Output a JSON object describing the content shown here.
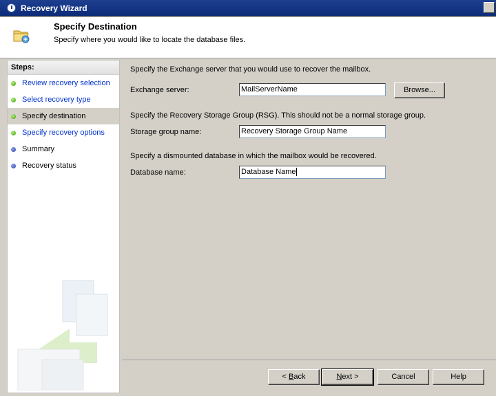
{
  "window": {
    "title": "Recovery Wizard"
  },
  "header": {
    "title": "Specify Destination",
    "subtitle": "Specify where you would like to locate the database files."
  },
  "steps": {
    "title": "Steps:",
    "items": [
      {
        "label": "Review recovery selection",
        "status": "complete",
        "link": true
      },
      {
        "label": "Select recovery type",
        "status": "complete",
        "link": true
      },
      {
        "label": "Specify destination",
        "status": "current",
        "link": false
      },
      {
        "label": "Specify recovery options",
        "status": "complete",
        "link": true
      },
      {
        "label": "Summary",
        "status": "pending",
        "link": false
      },
      {
        "label": "Recovery status",
        "status": "pending",
        "link": false
      }
    ]
  },
  "form": {
    "exchange_desc": "Specify the Exchange server that you would use to recover the mailbox.",
    "exchange_label": "Exchange server:",
    "exchange_value": "MailServerName",
    "browse_label": "Browse...",
    "rsg_desc": "Specify the Recovery Storage Group (RSG). This should not be a normal storage group.",
    "rsg_label": "Storage group name:",
    "rsg_value": "Recovery Storage Group Name",
    "db_desc": "Specify a dismounted database in which the mailbox would be recovered.",
    "db_label": "Database name:",
    "db_value": "Database Name"
  },
  "buttons": {
    "back_mnemonic": "B",
    "back_rest": "ack",
    "back_prefix": "< ",
    "next_mnemonic": "N",
    "next_rest": "ext",
    "next_suffix": " >",
    "cancel": "Cancel",
    "help": "Help"
  },
  "colors": {
    "titlebar": "#0c2c7a",
    "link": "#0033cc",
    "complete_dot": "#3a9a0a",
    "pending_dot": "#2b3fa3"
  }
}
